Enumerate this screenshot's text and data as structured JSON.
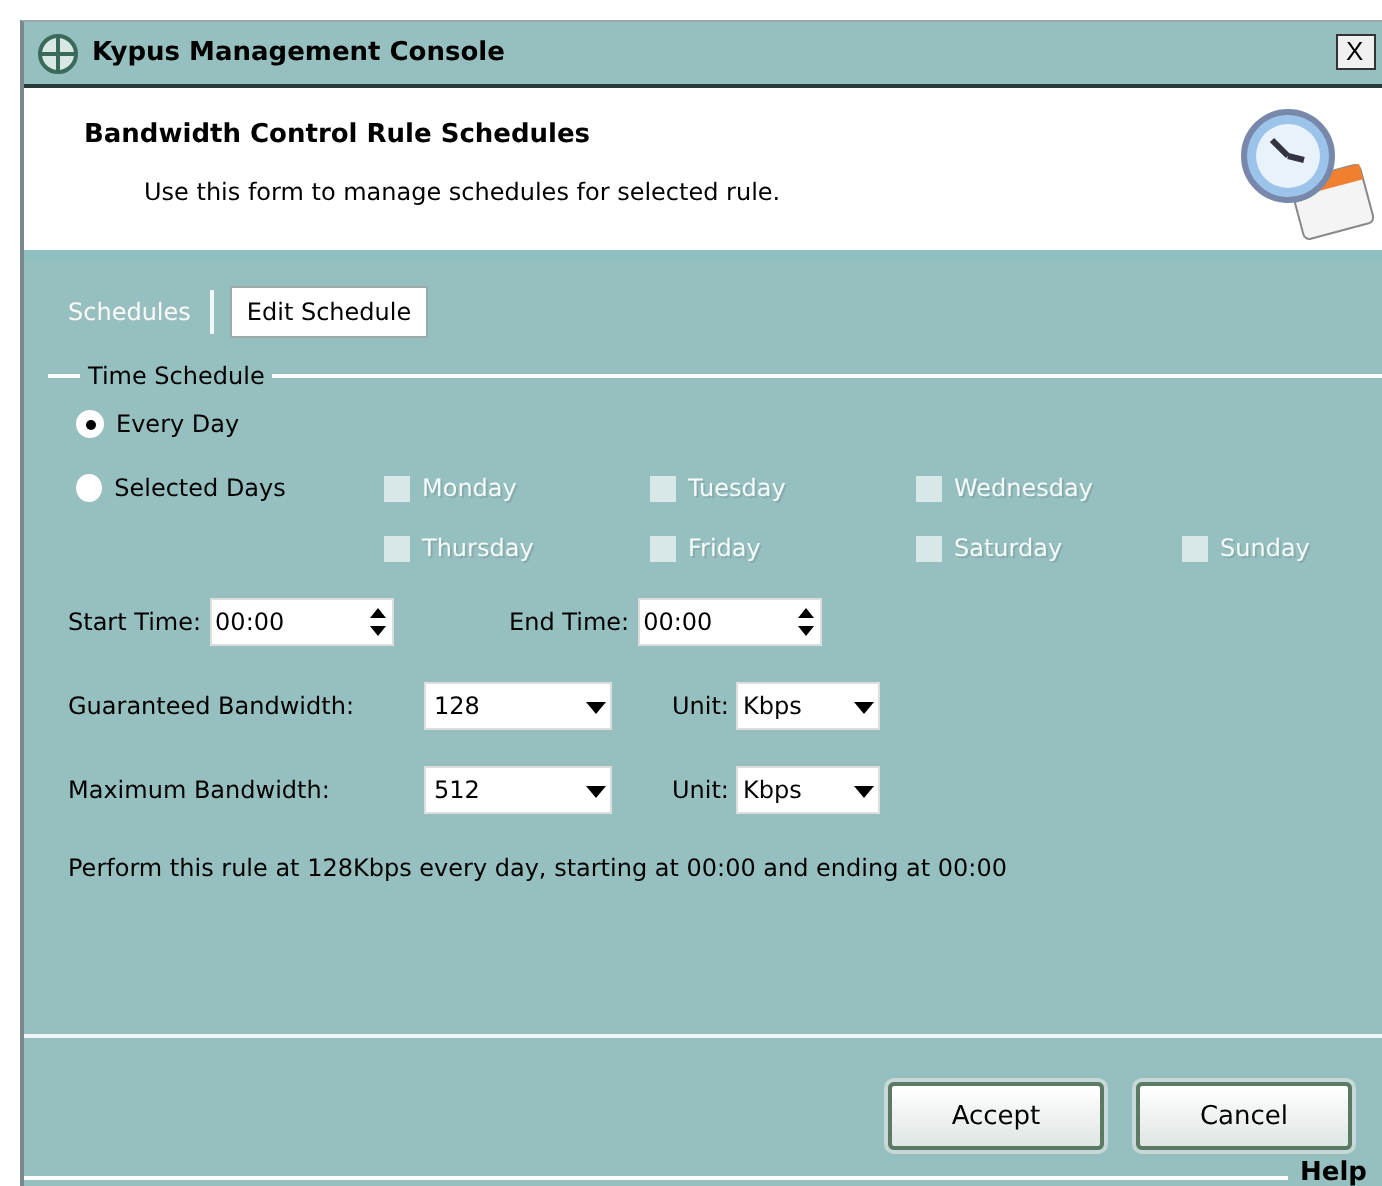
{
  "window": {
    "title": "Kypus Management Console",
    "close": "X"
  },
  "header": {
    "title": "Bandwidth Control Rule Schedules",
    "description": "Use this form to manage schedules for selected rule."
  },
  "tabs": [
    {
      "label": "Schedules",
      "selected": false
    },
    {
      "label": "Edit Schedule",
      "selected": true
    }
  ],
  "time_schedule": {
    "title": "Time Schedule",
    "options": [
      {
        "label": "Every Day",
        "selected": true
      },
      {
        "label": "Selected Days",
        "selected": false
      }
    ],
    "days": [
      {
        "label": "Monday",
        "checked": false,
        "disabled": true
      },
      {
        "label": "Tuesday",
        "checked": false,
        "disabled": true
      },
      {
        "label": "Wednesday",
        "checked": false,
        "disabled": true
      },
      {
        "label": "Thursday",
        "checked": false,
        "disabled": true
      },
      {
        "label": "Friday",
        "checked": false,
        "disabled": true
      },
      {
        "label": "Saturday",
        "checked": false,
        "disabled": true
      },
      {
        "label": "Sunday",
        "checked": false,
        "disabled": true
      }
    ],
    "start_time": {
      "label": "Start Time:",
      "value": "00:00"
    },
    "end_time": {
      "label": "End Time:",
      "value": "00:00"
    }
  },
  "bandwidth": [
    {
      "label": "Guaranteed Bandwidth:",
      "value": "128",
      "unit_label": "Unit:",
      "unit": "Kbps"
    },
    {
      "label": "Maximum Bandwidth:",
      "value": "512",
      "unit_label": "Unit:",
      "unit": "Kbps"
    }
  ],
  "summary": "Perform this rule at 128Kbps every day, starting at 00:00 and ending at 00:00",
  "buttons": [
    "Accept",
    "Cancel"
  ],
  "footer": {
    "help": "Help"
  }
}
